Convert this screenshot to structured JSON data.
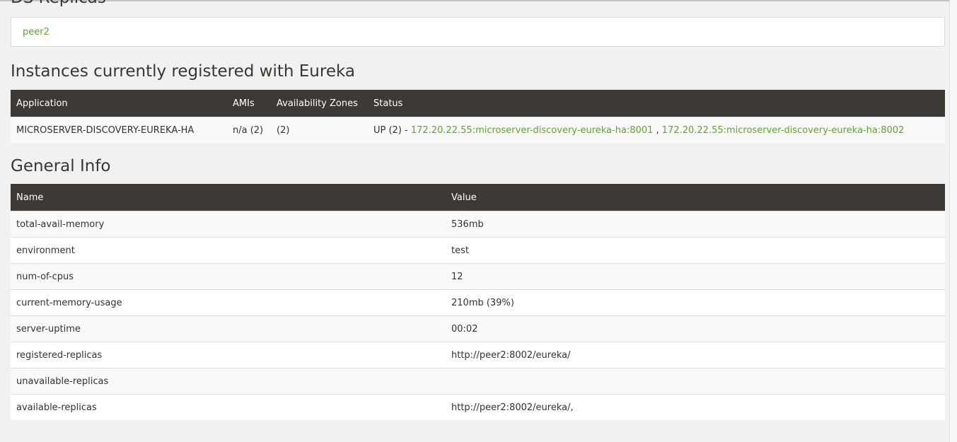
{
  "replicas": {
    "title": "DS Replicas",
    "items": [
      "peer2"
    ]
  },
  "instances": {
    "title": "Instances currently registered with Eureka",
    "headers": [
      "Application",
      "AMIs",
      "Availability Zones",
      "Status"
    ],
    "rows": [
      {
        "application": "MICROSERVER-DISCOVERY-EUREKA-HA",
        "amis": "n/a (2)",
        "zones": "(2)",
        "status": "UP (2) - ",
        "links": [
          "172.20.22.55:microserver-discovery-eureka-ha:8001",
          "172.20.22.55:microserver-discovery-eureka-ha:8002"
        ],
        "separator": " , "
      }
    ]
  },
  "general": {
    "title": "General Info",
    "headers": [
      "Name",
      "Value"
    ],
    "rows": [
      {
        "name": "total-avail-memory",
        "value": "536mb"
      },
      {
        "name": "environment",
        "value": "test"
      },
      {
        "name": "num-of-cpus",
        "value": "12"
      },
      {
        "name": "current-memory-usage",
        "value": "210mb (39%)"
      },
      {
        "name": "server-uptime",
        "value": "00:02"
      },
      {
        "name": "registered-replicas",
        "value": "http://peer2:8002/eureka/"
      },
      {
        "name": "unavailable-replicas",
        "value": ""
      },
      {
        "name": "available-replicas",
        "value": "http://peer2:8002/eureka/,"
      }
    ]
  },
  "colors": {
    "link": "#5ea533",
    "header": "#3d3a35",
    "background": "#f1f1f1"
  }
}
